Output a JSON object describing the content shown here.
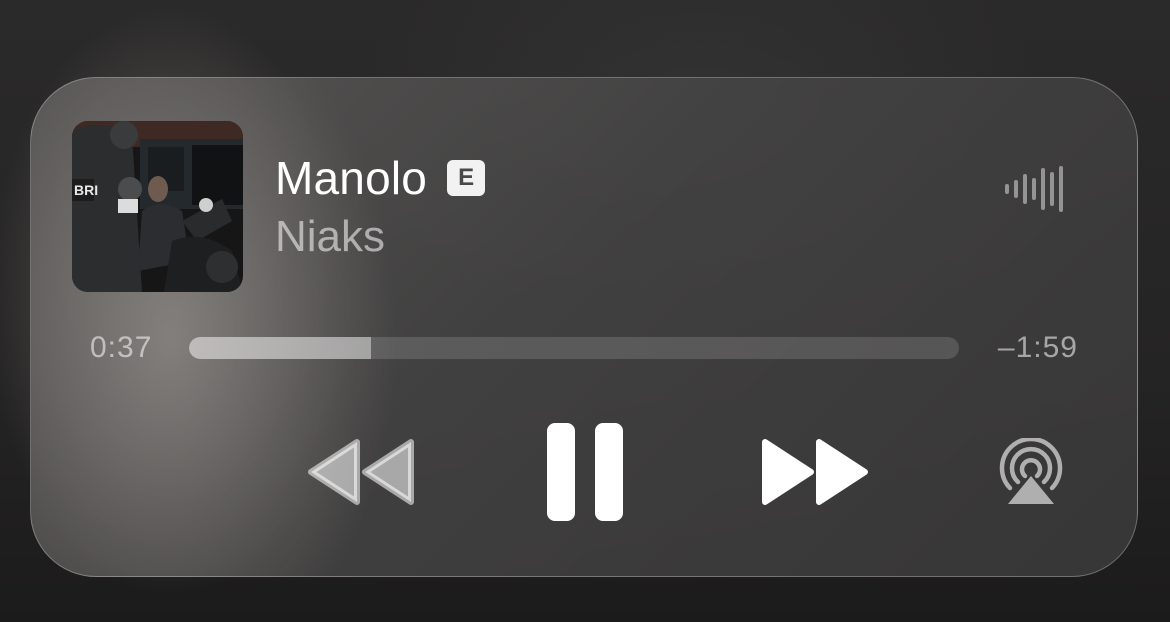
{
  "now_playing": {
    "title": "Manolo",
    "explicit_badge": "E",
    "artist": "Niaks",
    "artwork_icon": "album-artwork",
    "artwork_text": "BRI"
  },
  "progress": {
    "elapsed": "0:37",
    "remaining": "–1:59",
    "fraction": 0.237
  },
  "controls": {
    "rewind_icon": "rewind-icon",
    "pause_icon": "pause-icon",
    "forward_icon": "fast-forward-icon",
    "airplay_icon": "airplay-audio-icon",
    "waveform_icon": "audio-waveform-icon"
  },
  "colors": {
    "primary_text": "#ffffff",
    "secondary_text": "#9a9999",
    "widget_background": "#555454"
  }
}
